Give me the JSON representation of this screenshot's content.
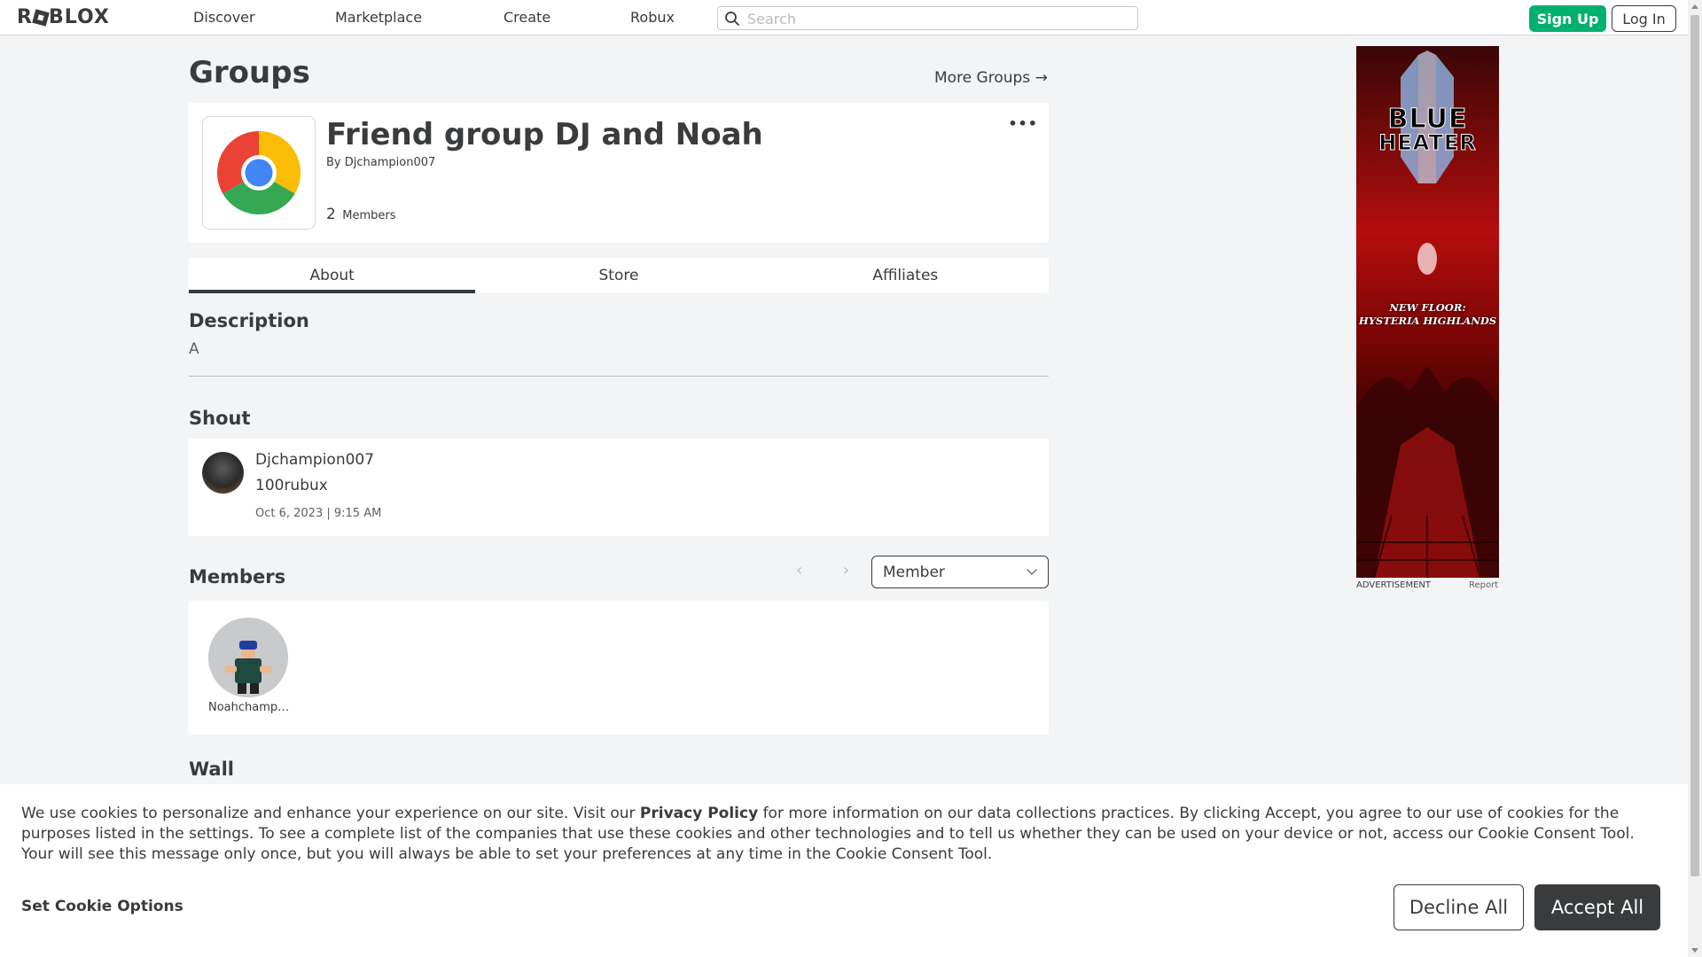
{
  "header": {
    "logo_text": "ROBLOX",
    "nav": [
      "Discover",
      "Marketplace",
      "Create",
      "Robux"
    ],
    "search_placeholder": "Search",
    "signup_label": "Sign Up",
    "login_label": "Log In"
  },
  "page": {
    "title": "Groups",
    "more_groups": "More Groups →"
  },
  "group": {
    "name": "Friend group DJ and Noah",
    "by_label": "By",
    "owner": "Djchampion007",
    "member_count": "2",
    "members_label": "Members"
  },
  "tabs": [
    "About",
    "Store",
    "Affiliates"
  ],
  "description": {
    "title": "Description",
    "text": "A"
  },
  "shout": {
    "title": "Shout",
    "user": "Djchampion007",
    "body": "100rubux",
    "date": "Oct 6, 2023 | 9:15 AM"
  },
  "members": {
    "title": "Members",
    "filter_value": "Member",
    "list": [
      {
        "name": "Noahchampi..."
      }
    ]
  },
  "wall": {
    "title": "Wall"
  },
  "ad": {
    "title_line1": "BLUE",
    "title_line2": "HEATER",
    "subtitle_line1": "NEW FLOOR:",
    "subtitle_line2": "HYSTERIA HIGHLANDS",
    "advertisement_label": "ADVERTISEMENT",
    "report_label": "Report"
  },
  "cookie": {
    "text_before": "We use cookies to personalize and enhance your experience on our site. Visit our ",
    "privacy_link": "Privacy Policy",
    "text_after": " for more information on our data collections practices. By clicking Accept, you agree to our use of cookies for the purposes listed in the settings. To see a complete list of the companies that use these cookies and other technologies and to tell us whether they can be used on your device or not, access our Cookie Consent Tool. Your will see this message only once, but you will always be able to set your preferences at any time in the Cookie Consent Tool.",
    "options_label": "Set Cookie Options",
    "decline_label": "Decline All",
    "accept_label": "Accept All"
  },
  "colors": {
    "signup_green": "#00b06f",
    "text_dark": "#393b3d",
    "page_bg": "#f2f4f5"
  }
}
